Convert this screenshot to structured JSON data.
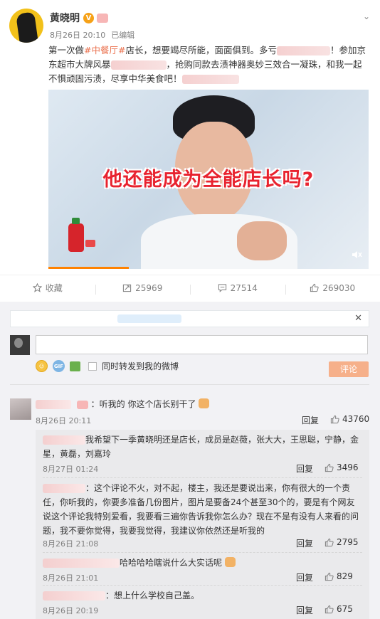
{
  "post": {
    "author": "黄晓明",
    "verified_mark": "V",
    "time": "8月26日 20:10",
    "edited": "已编辑",
    "text_part1": "第一次做",
    "hashtag": "#中餐厅#",
    "text_part2": "店长，想要竭尽所能，面面俱到。多亏",
    "text_part3": "！参加京东超市大牌风暴",
    "text_part4": "，抢购同款去渍神器奥妙三效合一凝珠，和我一起不惧顽固污渍，尽享中华美食吧！",
    "video_caption": "他还能成为全能店长吗?",
    "video_progress": 0.25
  },
  "actions": {
    "favorite": "收藏",
    "repost_count": "25969",
    "comment_count": "27514",
    "like_count": "269030"
  },
  "composer": {
    "forward_label": "同时转发到我的微博",
    "submit": "评论",
    "gif_label": "GIF"
  },
  "comments": [
    {
      "text": "：听我的 你这个店长别干了",
      "date": "8月26日 20:11",
      "reply": "回复",
      "likes": "43760"
    }
  ],
  "replies": [
    {
      "text": "我希望下一季黄晓明还是店长，成员是赵薇，张大大，王思聪，宁静，金星，黄磊，刘嘉玲",
      "date": "8月27日 01:24",
      "reply": "回复",
      "likes": "3496"
    },
    {
      "text": "：这个评论不火，对不起，楼主，我还是要说出来，你有很大的一个责任，你听我的，你要多准备几份图片，图片是要备24个甚至30个的，要是有个网友说这个评论我特别爱看，我要看三遍你告诉我你怎么办？现在不是有没有人来看的问题，我不要你觉得，我要我觉得，我建议你依然还是听我的",
      "date": "8月26日 21:08",
      "reply": "回复",
      "likes": "2795"
    },
    {
      "text": "哈哈哈哈瞎说什么大实话呢",
      "date": "8月26日 21:01",
      "reply": "回复",
      "likes": "829"
    },
    {
      "text": "：想上什么学校自己盖。",
      "date": "8月26日 20:19",
      "reply": "回复",
      "likes": "675"
    }
  ]
}
